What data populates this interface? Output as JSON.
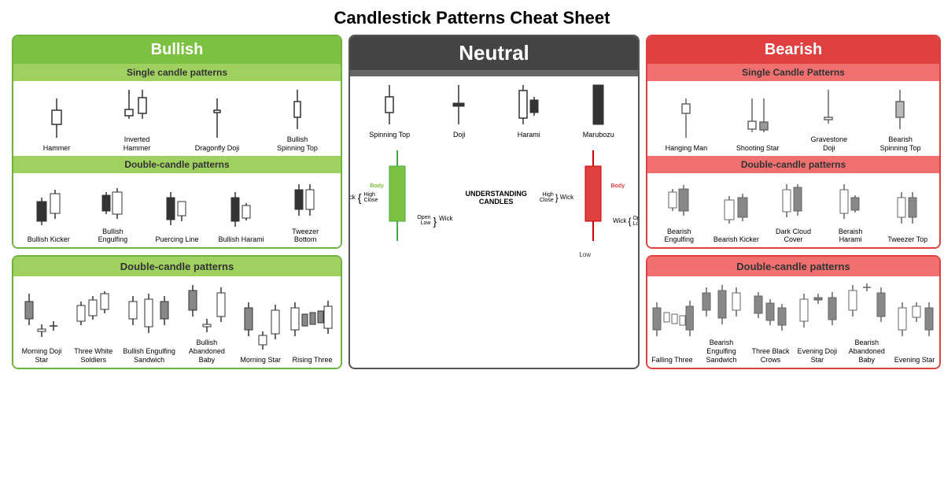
{
  "title": "Candlestick Patterns Cheat Sheet",
  "sections": {
    "bullish": {
      "header": "Bullish",
      "single_header": "Single candle patterns",
      "single_patterns": [
        {
          "label": "Hammer"
        },
        {
          "label": "Inverted Hammer"
        },
        {
          "label": "Dragonfly Doji"
        },
        {
          "label": "Bullish Spinning Top"
        }
      ],
      "double_header": "Double-candle patterns",
      "double_patterns": [
        {
          "label": "Bullish Kicker"
        },
        {
          "label": "Bullish Engulfing"
        },
        {
          "label": "Puercing Line"
        },
        {
          "label": "Bullish Harami"
        },
        {
          "label": "Tweezer Bottom"
        }
      ]
    },
    "bullish_bottom": {
      "header": "Double-candle patterns",
      "patterns": [
        {
          "label": "Morning Doji Star"
        },
        {
          "label": "Three White Soldiers"
        },
        {
          "label": "Bullish Engulfing Sandwich"
        },
        {
          "label": "Bullish Abandoned Baby"
        },
        {
          "label": "Morning Star"
        },
        {
          "label": "Rising Three"
        }
      ]
    },
    "neutral": {
      "header": "Neutral",
      "patterns": [
        {
          "label": "Spinning Top"
        },
        {
          "label": "Doji"
        },
        {
          "label": "Harami"
        },
        {
          "label": "Marubozu"
        }
      ]
    },
    "bearish": {
      "header": "Bearish",
      "single_header": "Single Candle Patterns",
      "single_patterns": [
        {
          "label": "Hanging Man"
        },
        {
          "label": "Shooting Star"
        },
        {
          "label": "Gravestone Doji"
        },
        {
          "label": "Bearish Spinning Top"
        }
      ],
      "double_header": "Double-candle patterns",
      "double_patterns": [
        {
          "label": "Bearish Engulfing"
        },
        {
          "label": "Bearish Kicker"
        },
        {
          "label": "Dark Cloud Cover"
        },
        {
          "label": "Beraish Harami"
        },
        {
          "label": "Tweezer Top"
        }
      ]
    },
    "bearish_bottom": {
      "header": "Double-candle patterns",
      "patterns": [
        {
          "label": "Falling Three"
        },
        {
          "label": "Bearish Engulfing Sandwich"
        },
        {
          "label": "Three Black Crows"
        },
        {
          "label": "Evening Doji Star"
        },
        {
          "label": "Bearish Abandoned Baby"
        },
        {
          "label": "Evening Star"
        }
      ]
    }
  }
}
